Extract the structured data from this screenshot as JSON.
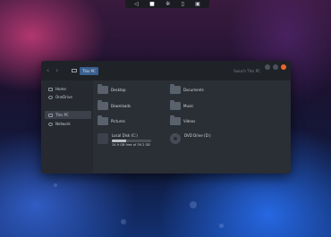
{
  "taskbar": {
    "items": [
      {
        "icon": "volume-icon",
        "glyph": "◁"
      },
      {
        "icon": "folder-icon",
        "glyph": "■"
      },
      {
        "icon": "settings-icon",
        "glyph": "✲"
      },
      {
        "icon": "files-icon",
        "glyph": "▯"
      },
      {
        "icon": "calendar-icon",
        "glyph": "▣"
      }
    ]
  },
  "window": {
    "back_glyph": "‹",
    "forward_glyph": "›",
    "breadcrumb": "This PC",
    "search_placeholder": "Search This PC",
    "colors": {
      "close": "#e8682d",
      "btn": "#4b515b",
      "accent": "#3a5f8f"
    }
  },
  "sidebar": {
    "items": [
      {
        "label": "Home",
        "icon": "home-icon"
      },
      {
        "label": "OneDrive",
        "icon": "cloud-icon"
      },
      {
        "label": "This PC",
        "icon": "computer-icon",
        "selected": true
      },
      {
        "label": "Network",
        "icon": "network-icon"
      }
    ]
  },
  "folders": [
    {
      "name": "Desktop"
    },
    {
      "name": "Documents"
    },
    {
      "name": "Downloads"
    },
    {
      "name": "Music"
    },
    {
      "name": "Pictures"
    },
    {
      "name": "Videos"
    }
  ],
  "drives": [
    {
      "name": "Local Disk (C:)",
      "free": "24.9 GB free of 39.2 GB",
      "used_fraction": 0.36,
      "icon": "windows-drive-icon"
    },
    {
      "name": "DVD Drive (D:)",
      "icon": "disc-icon"
    }
  ]
}
